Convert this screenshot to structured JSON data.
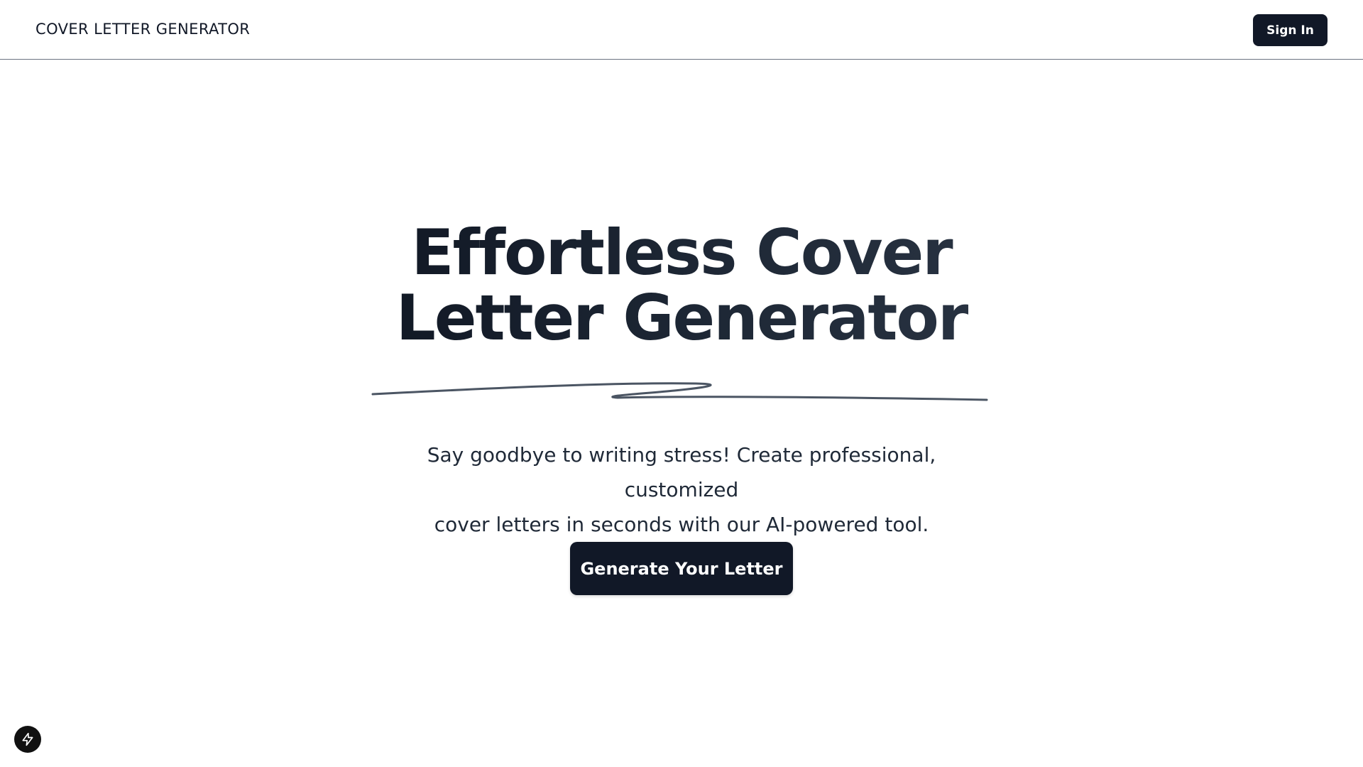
{
  "header": {
    "brand": "COVER LETTER GENERATOR",
    "sign_in_label": "Sign In"
  },
  "hero": {
    "title_line1": "Effortless Cover",
    "title_line2": "Letter Generator",
    "subtitle_line1": "Say goodbye to writing stress! Create professional, customized",
    "subtitle_line2": "cover letters in seconds with our AI-powered tool.",
    "cta_label": "Generate Your Letter"
  },
  "icons": {
    "scribble": "scribble-underline-icon",
    "dev_badge": "lightning-icon"
  },
  "colors": {
    "primary": "#111827",
    "text": "#1f2937",
    "underline": "#4b5563",
    "background": "#ffffff"
  }
}
